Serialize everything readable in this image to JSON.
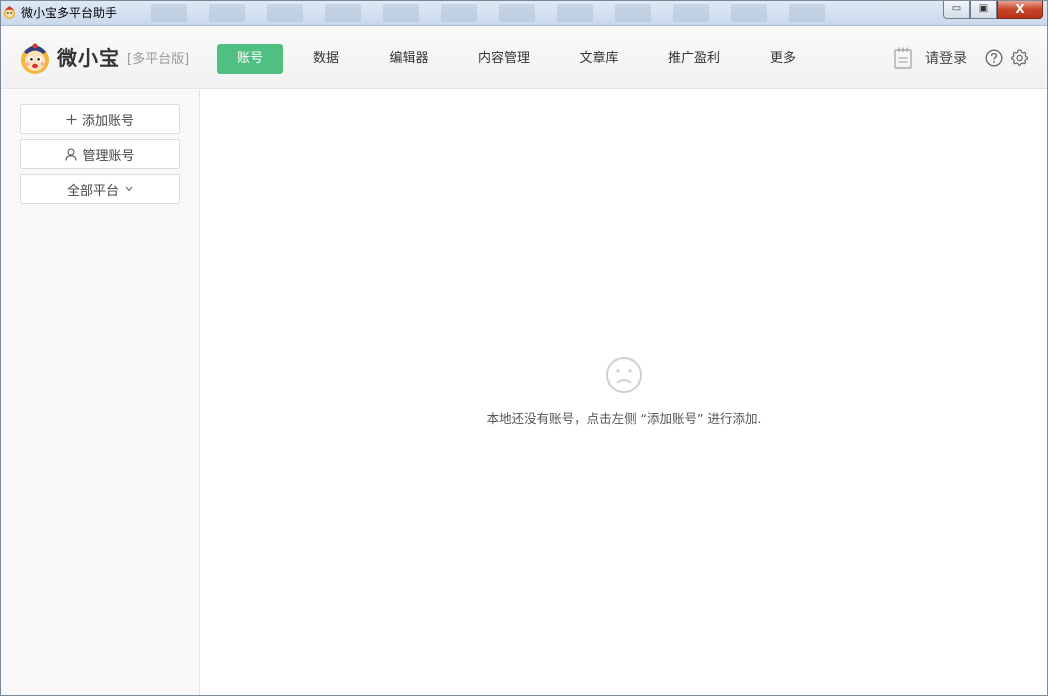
{
  "window": {
    "title": "微小宝多平台助手",
    "controls": {
      "minimize": "▭",
      "maximize": "▣",
      "close": "X"
    }
  },
  "header": {
    "brand": "微小宝",
    "edition": "[多平台版]",
    "nav": [
      {
        "label": "账号",
        "active": true
      },
      {
        "label": "数据",
        "active": false
      },
      {
        "label": "编辑器",
        "active": false
      },
      {
        "label": "内容管理",
        "active": false
      },
      {
        "label": "文章库",
        "active": false
      },
      {
        "label": "推广盈利",
        "active": false
      },
      {
        "label": "更多",
        "active": false
      }
    ],
    "login_label": "请登录",
    "icons": [
      "notepad-icon",
      "help-icon",
      "gear-icon"
    ]
  },
  "sidebar": {
    "add_account": "添加账号",
    "manage_account": "管理账号",
    "platform_filter": "全部平台"
  },
  "main": {
    "empty_message": "本地还没有账号，点击左侧 “添加账号” 进行添加."
  },
  "colors": {
    "accent": "#4fc081",
    "text": "#333333",
    "muted": "#999999"
  }
}
